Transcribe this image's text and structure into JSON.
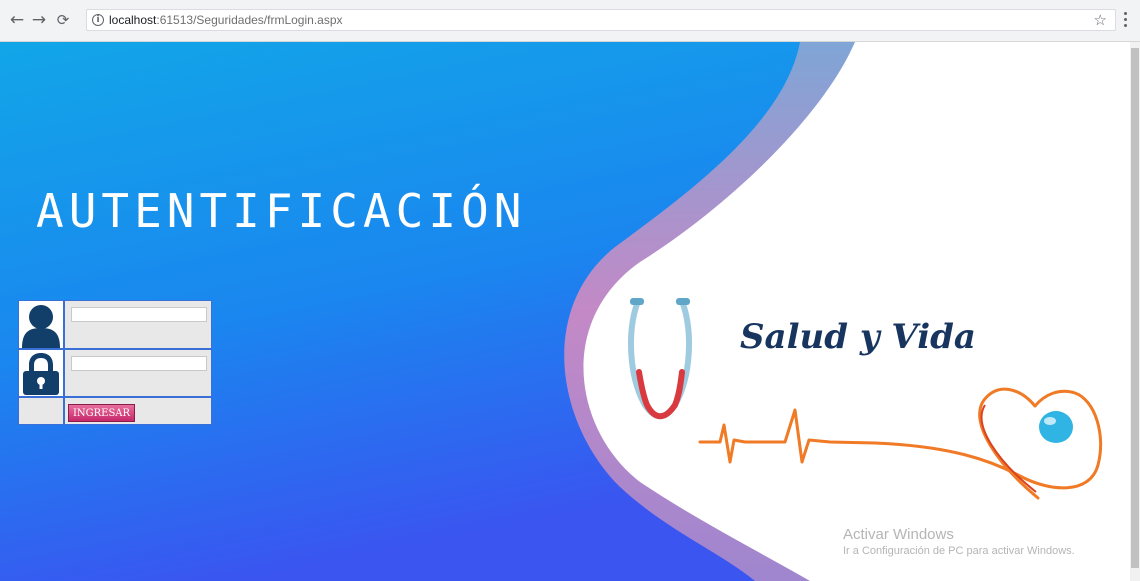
{
  "browser": {
    "url_host": "localhost",
    "url_path": ":61513/Seguridades/frmLogin.aspx",
    "icons": {
      "back": "back-arrow-icon",
      "forward": "forward-arrow-icon",
      "reload": "reload-icon",
      "info": "info-icon",
      "bookmark": "star-icon",
      "menu": "menu-dots-icon"
    }
  },
  "page": {
    "heading": "AUTENTIFICACIÓN",
    "login": {
      "username_value": "",
      "password_value": "",
      "submit_label": "INGRESAR",
      "icons": {
        "user": "user-icon",
        "password": "lock-icon"
      }
    },
    "logo": {
      "text": "Salud y Vida",
      "icon": "stethoscope-heart-icon"
    },
    "watermark": {
      "title": "Activar Windows",
      "subtitle": "Ir a Configuración de PC para activar Windows."
    },
    "colors": {
      "bg_blue": "#0a7fe8",
      "wave_purple": "#b57fc4",
      "button_pink": "#d13c7c",
      "logo_text": "#17355f"
    }
  }
}
